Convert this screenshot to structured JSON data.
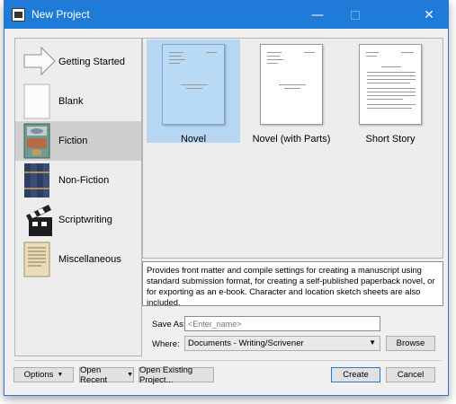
{
  "window": {
    "title": "New Project",
    "controls": {
      "minimize": "—",
      "close": "✕"
    }
  },
  "categories": [
    {
      "label": "Getting Started",
      "icon": "arrow-icon"
    },
    {
      "label": "Blank",
      "icon": "blank-page-icon"
    },
    {
      "label": "Fiction",
      "icon": "book-icon",
      "selected": true
    },
    {
      "label": "Non-Fiction",
      "icon": "books-icon"
    },
    {
      "label": "Scriptwriting",
      "icon": "clapperboard-icon"
    },
    {
      "label": "Miscellaneous",
      "icon": "paper-icon"
    }
  ],
  "templates": [
    {
      "label": "Novel",
      "selected": true
    },
    {
      "label": "Novel (with Parts)",
      "selected": false
    },
    {
      "label": "Short Story",
      "selected": false
    }
  ],
  "description": "Provides front matter and compile settings for creating a manuscript using standard submission format, for creating a self-published paperback novel, or for exporting as an e-book. Character and location sketch sheets are also included.",
  "save_as": {
    "label": "Save As:",
    "placeholder": "<Enter_name>"
  },
  "where": {
    "label": "Where:",
    "value": "Documents - Writing/Scrivener",
    "browse_label": "Browse"
  },
  "bottom": {
    "options_label": "Options",
    "open_recent_label": "Open Recent",
    "open_existing_label": "Open Existing Project...",
    "create_label": "Create",
    "cancel_label": "Cancel"
  },
  "colors": {
    "titlebar": "#1f7bd8",
    "selection": "#b7d6f2"
  }
}
